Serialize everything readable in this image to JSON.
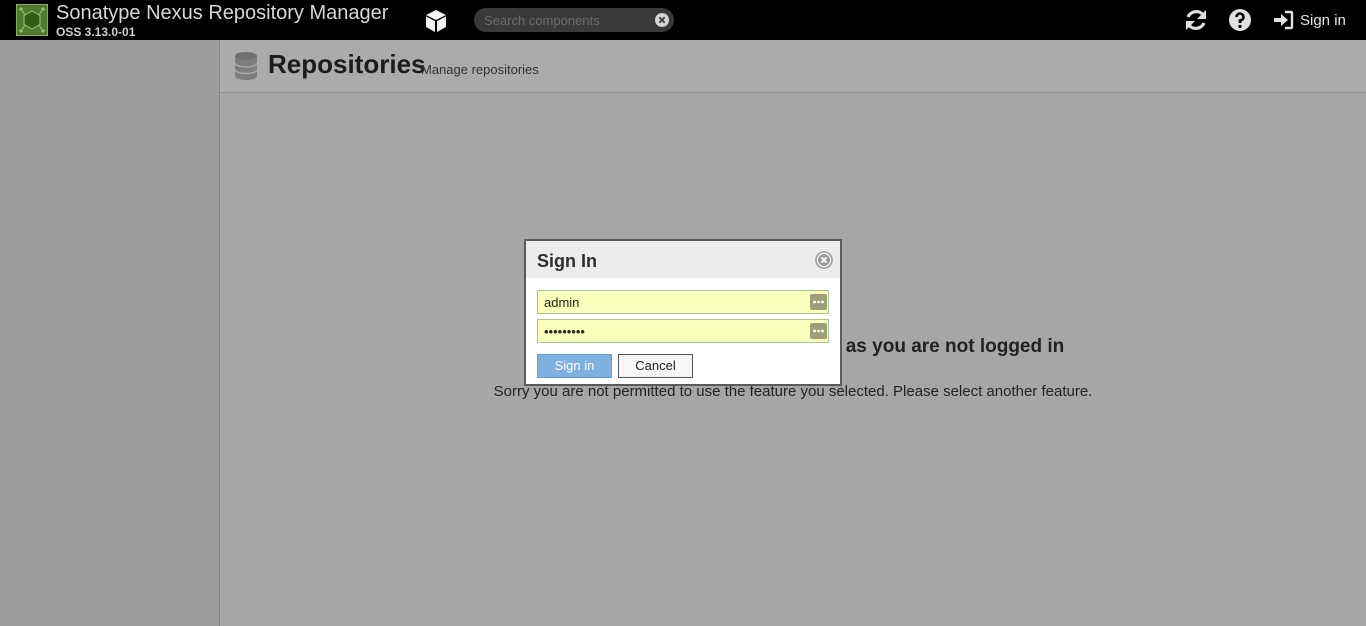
{
  "header": {
    "app_title": "Sonatype Nexus Repository Manager",
    "version": "OSS 3.13.0-01",
    "search_placeholder": "Search components",
    "signin_label": "Sign in",
    "icons": [
      "nexus-logo-icon",
      "cube-icon",
      "clear-icon",
      "refresh-icon",
      "help-icon",
      "sign-in-icon"
    ]
  },
  "page": {
    "title": "Repositories",
    "subtitle": "Manage repositories",
    "icon": "database-icon"
  },
  "message": {
    "title_visible": "as you are not logged in",
    "body": "Sorry you are not permitted to use the feature you selected. Please select another feature."
  },
  "dialog": {
    "title": "Sign In",
    "username_value": "admin",
    "password_value": "•••••••••",
    "signin_label": "Sign in",
    "cancel_label": "Cancel"
  },
  "colors": {
    "topbar": "#000000",
    "overlay": "#a6a6a6",
    "field_autofill": "#fbffbc",
    "primary_button": "#7fb1e0"
  }
}
